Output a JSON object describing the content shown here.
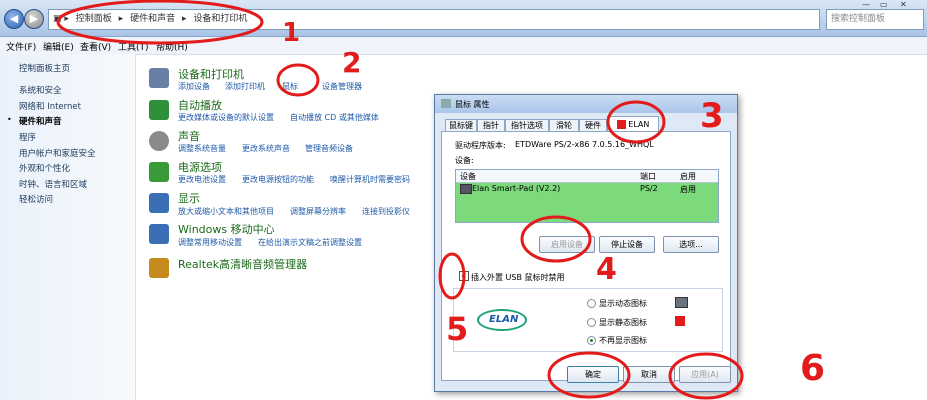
{
  "address": {
    "crumbs": [
      "控制面板",
      "硬件和声音",
      "设备和打印机"
    ],
    "search_placeholder": "搜索控制面板"
  },
  "menu": [
    "文件(F)",
    "编辑(E)",
    "查看(V)",
    "工具(T)",
    "帮助(H)"
  ],
  "left_pane": {
    "home": "控制面板主页",
    "items": [
      "系统和安全",
      "网络和 Internet",
      "硬件和声音",
      "程序",
      "用户帐户和家庭安全",
      "外观和个性化",
      "时钟、语言和区域",
      "轻松访问"
    ],
    "current_index": 2
  },
  "categories": [
    {
      "title": "设备和打印机",
      "links": [
        "添加设备",
        "添加打印机",
        "鼠标",
        "设备管理器"
      ],
      "color": "#6a7fa5"
    },
    {
      "title": "自动播放",
      "links": [
        "更改媒体或设备的默认设置",
        "自动播放 CD 或其他媒体"
      ],
      "color": "#2f8f3a"
    },
    {
      "title": "声音",
      "links": [
        "调整系统音量",
        "更改系统声音",
        "管理音频设备"
      ],
      "color": "#8a8a8a"
    },
    {
      "title": "电源选项",
      "links": [
        "更改电池设置",
        "更改电源按钮的功能",
        "唤醒计算机时需要密码"
      ],
      "color": "#3a9a3a"
    },
    {
      "title": "显示",
      "links": [
        "放大或缩小文本和其他项目",
        "调整屏幕分辨率",
        "连接到投影仪"
      ],
      "color": "#3a6fb8"
    },
    {
      "title": "Windows 移动中心",
      "links": [
        "调整常用移动设置",
        "在给出演示文稿之前调整设置"
      ],
      "color": "#3a6fb8"
    },
    {
      "title": "Realtek高清晰音频管理器",
      "links": [],
      "color": "#c58a1a"
    }
  ],
  "dialog": {
    "title": "鼠标 属性",
    "tabs": [
      "鼠标键",
      "指针",
      "指针选项",
      "滑轮",
      "硬件",
      "ELAN"
    ],
    "driver_label": "驱动程序版本:",
    "driver_value": "ETDWare PS/2-x86 7.0.5.16_WHQL",
    "devices_label": "设备:",
    "table_headers": [
      "设备",
      "端口",
      "启用"
    ],
    "device_row": {
      "name": "Elan Smart-Pad (V2.2)",
      "port": "PS/2",
      "enabled": "启用"
    },
    "buttons_device": [
      "启用设备",
      "停止设备",
      "选项..."
    ],
    "checkbox_label": "插入外置 USB 鼠标时禁用",
    "logo_text": "ELAN",
    "radio_options": [
      "显示动态图标",
      "显示静态图标",
      "不再显示图标"
    ],
    "radio_selected": 2,
    "footer_buttons": [
      "确定",
      "取消",
      "应用(A)"
    ]
  },
  "annotations": [
    "1",
    "2",
    "3",
    "4",
    "5",
    "6"
  ],
  "colors": {
    "annotation": "#e21b1b",
    "device_highlight": "#7cd97c"
  }
}
